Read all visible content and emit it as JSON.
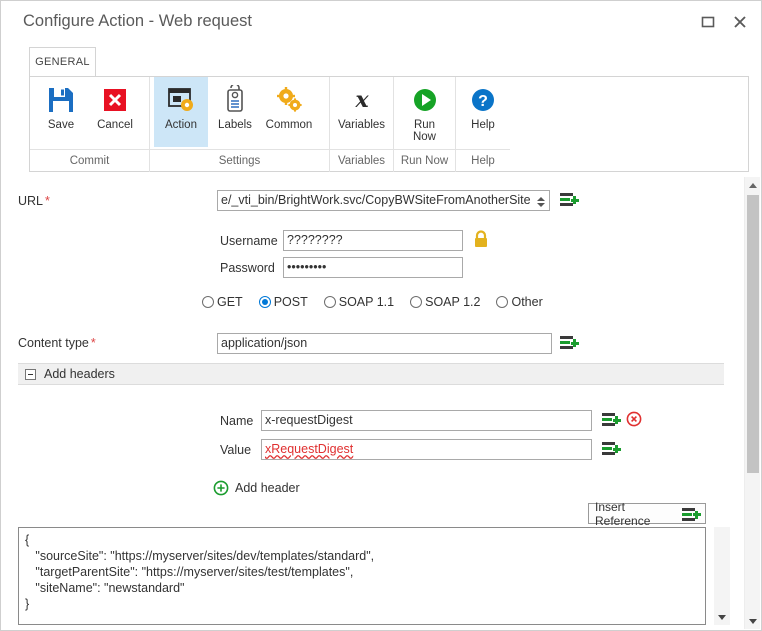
{
  "window": {
    "title": "Configure Action - Web request",
    "controls": {
      "maximize": "maximize-icon",
      "close": "close-icon"
    }
  },
  "tabs": [
    {
      "label": "GENERAL",
      "active": true
    }
  ],
  "ribbon": {
    "groups": [
      {
        "label": "Commit",
        "buttons": [
          {
            "label": "Save",
            "icon": "save-floppy-icon",
            "selected": false
          },
          {
            "label": "Cancel",
            "icon": "cancel-x-icon",
            "selected": false
          }
        ]
      },
      {
        "label": "Settings",
        "buttons": [
          {
            "label": "Action",
            "icon": "action-window-gear-icon",
            "selected": true
          },
          {
            "label": "Labels",
            "icon": "labels-tag-icon",
            "selected": false
          },
          {
            "label": "Common",
            "icon": "common-gears-icon",
            "selected": false
          }
        ]
      },
      {
        "label": "Variables",
        "buttons": [
          {
            "label": "Variables",
            "icon": "variables-x-icon",
            "selected": false
          }
        ]
      },
      {
        "label": "Run Now",
        "buttons": [
          {
            "label": "Run\nNow",
            "label_line1": "Run",
            "label_line2": "Now",
            "icon": "run-now-play-icon",
            "selected": false
          }
        ]
      },
      {
        "label": "Help",
        "buttons": [
          {
            "label": "Help",
            "icon": "help-question-icon",
            "selected": false
          }
        ]
      }
    ]
  },
  "form": {
    "url": {
      "label": "URL",
      "required": "*",
      "value": "e/_vti_bin/BrightWork.svc/CopyBWSiteFromAnotherSite",
      "spinner": "spinner-updown-icon",
      "insert_reference_icon": "insert-reference-icon"
    },
    "username": {
      "label": "Username",
      "value": "????????",
      "lock_icon": "lock-icon"
    },
    "password": {
      "label": "Password",
      "value": "•••••••••"
    },
    "methods": [
      {
        "label": "GET",
        "selected": false
      },
      {
        "label": "POST",
        "selected": true
      },
      {
        "label": "SOAP 1.1",
        "selected": false
      },
      {
        "label": "SOAP 1.2",
        "selected": false
      },
      {
        "label": "Other",
        "selected": false
      }
    ],
    "content_type": {
      "label": "Content type",
      "required": "*",
      "value": "application/json",
      "insert_reference_icon": "insert-reference-icon"
    },
    "headers_section": {
      "label": "Add headers",
      "collapse_icon": "collapse-minus-icon",
      "rows": [
        {
          "name_label": "Name",
          "name_value": "x-requestDigest",
          "value_label": "Value",
          "value_value": "xRequestDigest",
          "delete_icon": "delete-circle-x-icon",
          "insert_reference_icon": "insert-reference-icon"
        }
      ],
      "add_header": {
        "label": "Add header",
        "icon": "add-circle-plus-icon"
      }
    },
    "insert_reference_button": {
      "label": "Insert Reference",
      "icon": "insert-reference-icon"
    },
    "request_body": "{\n   \"sourceSite\": \"https://myserver/sites/dev/templates/standard\",\n   \"targetParentSite\": \"https://myserver/sites/test/templates\",\n   \"siteName\": \"newstandard\"\n}"
  },
  "colors": {
    "accent": "#0078d7",
    "selected_tab_bg": "#cde6f7",
    "save_blue": "#1b6ec2",
    "cancel_red": "#e81123",
    "gear_orange": "#f0ab1b",
    "run_green": "#16a326",
    "help_blue": "#0a74c8",
    "lock_gold": "#e3b21e",
    "delete_red": "#e03030",
    "add_green": "#1a9c2e",
    "error_red": "#e03030"
  }
}
